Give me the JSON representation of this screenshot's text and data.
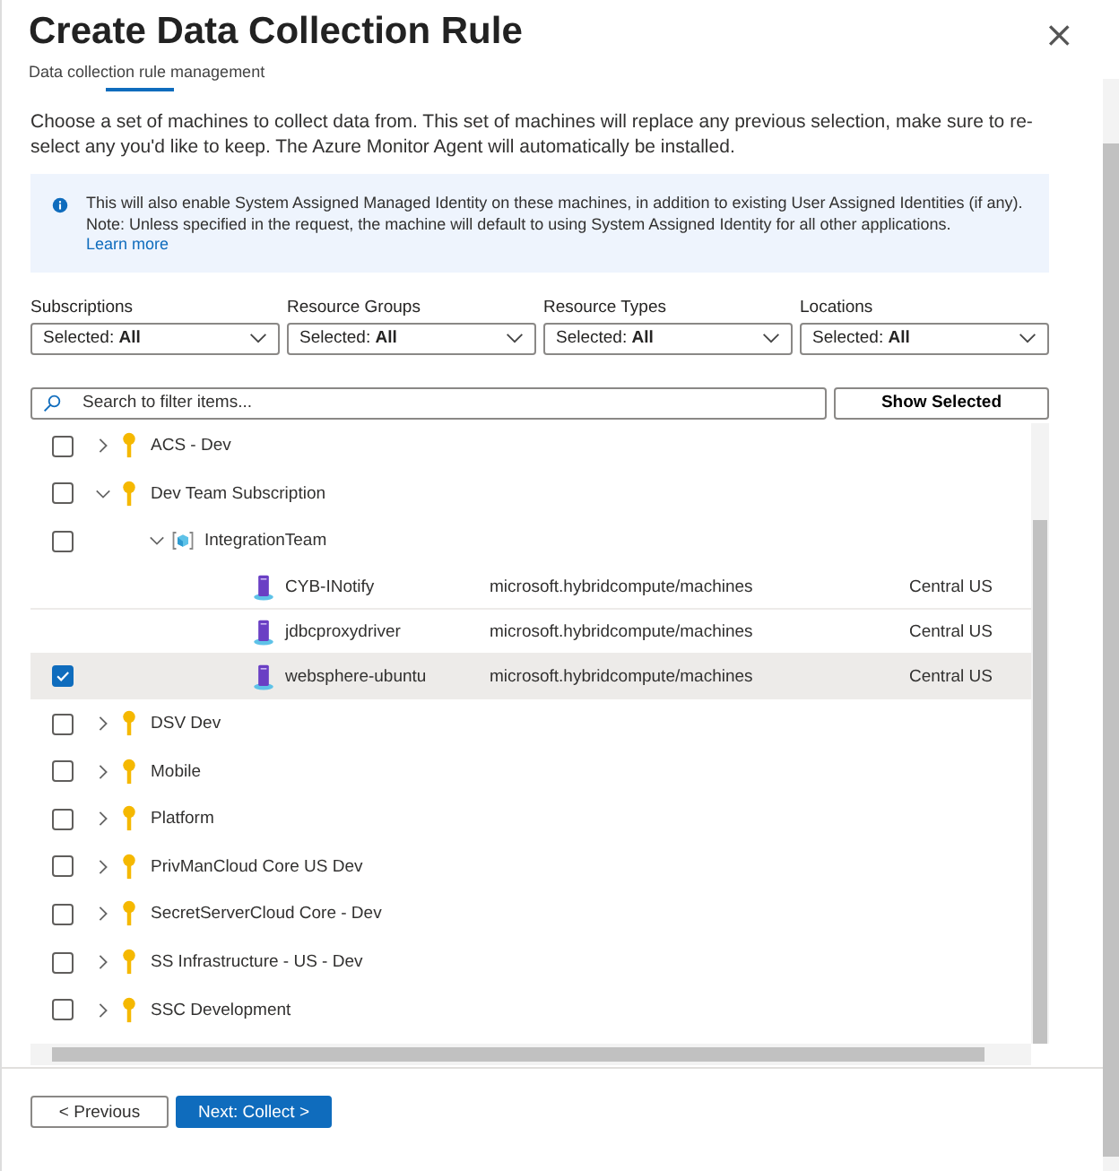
{
  "window": {
    "title": "Create Data Collection Rule",
    "subtitle": "Data collection rule management",
    "close": "×"
  },
  "description": "Choose a set of machines to collect data from. This set of machines will replace any previous selection, make sure to re-select any you'd like to keep. The Azure Monitor Agent will automatically be installed.",
  "info": {
    "text": "This will also enable System Assigned Managed Identity on these machines, in addition to existing User Assigned Identities (if any). Note: Unless specified in the request, the machine will default to using System Assigned Identity for all other applications.",
    "link": "Learn more"
  },
  "filters": [
    {
      "label": "Subscriptions",
      "prefix": "Selected:",
      "value": "All"
    },
    {
      "label": "Resource Groups",
      "prefix": "Selected:",
      "value": "All"
    },
    {
      "label": "Resource Types",
      "prefix": "Selected:",
      "value": "All"
    },
    {
      "label": "Locations",
      "prefix": "Selected:",
      "value": "All"
    }
  ],
  "search": {
    "placeholder": "Search to filter items..."
  },
  "show_selected_button": "Show Selected",
  "tree": [
    {
      "kind": "subscription",
      "name": "ACS - Dev",
      "checked": false,
      "expanded": false,
      "selected": false
    },
    {
      "kind": "subscription",
      "name": "Dev Team Subscription",
      "checked": false,
      "expanded": true,
      "selected": false,
      "children": [
        {
          "kind": "group",
          "name": "IntegrationTeam",
          "checked": false,
          "expanded": true,
          "selected": false,
          "children": [
            {
              "kind": "machine",
              "name": "CYB-INotify",
              "type": "microsoft.hybridcompute/machines",
              "location": "Central US",
              "checked": false,
              "selected": false
            },
            {
              "kind": "machine",
              "name": "jdbcproxydriver",
              "type": "microsoft.hybridcompute/machines",
              "location": "Central US",
              "checked": false,
              "selected": false
            },
            {
              "kind": "machine",
              "name": "websphere-ubuntu",
              "type": "microsoft.hybridcompute/machines",
              "location": "Central US",
              "checked": true,
              "selected": true
            }
          ]
        }
      ]
    },
    {
      "kind": "subscription",
      "name": "DSV Dev",
      "checked": false,
      "expanded": false,
      "selected": false
    },
    {
      "kind": "subscription",
      "name": "Mobile",
      "checked": false,
      "expanded": false,
      "selected": false
    },
    {
      "kind": "subscription",
      "name": "Platform",
      "checked": false,
      "expanded": false,
      "selected": false
    },
    {
      "kind": "subscription",
      "name": "PrivManCloud Core US Dev",
      "checked": false,
      "expanded": false,
      "selected": false
    },
    {
      "kind": "subscription",
      "name": "SecretServerCloud Core - Dev",
      "checked": false,
      "expanded": false,
      "selected": false
    },
    {
      "kind": "subscription",
      "name": "SS Infrastructure - US - Dev",
      "checked": false,
      "expanded": false,
      "selected": false
    },
    {
      "kind": "subscription",
      "name": "SSC Development",
      "checked": false,
      "expanded": false,
      "selected": false
    }
  ],
  "buttons": [
    {
      "label": "< Previous",
      "primary": false
    },
    {
      "label": "Next: Collect >",
      "primary": true
    }
  ]
}
